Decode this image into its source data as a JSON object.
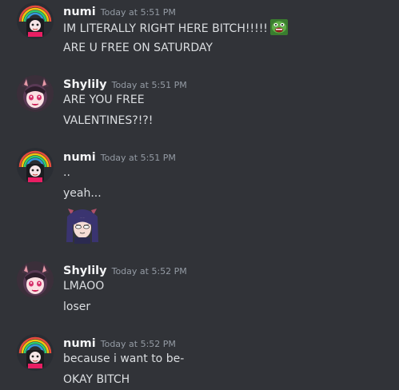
{
  "messages": [
    {
      "author": "numi",
      "timestamp": "Today at 5:51 PM",
      "lines": [
        "IM LITERALLY RIGHT HERE BITCH!!!!!",
        "ARE U FREE ON SATURDAY"
      ],
      "emote": "pepe-yelling-emote"
    },
    {
      "author": "Shylily",
      "timestamp": "Today at 5:51 PM",
      "lines": [
        "ARE YOU FREE",
        "VALENTINES?!?!"
      ]
    },
    {
      "author": "numi",
      "timestamp": "Today at 5:51 PM",
      "lines": [
        "..",
        "yeah..."
      ],
      "sticker": "anime-girl-sticker"
    },
    {
      "author": "Shylily",
      "timestamp": "Today at 5:52 PM",
      "lines": [
        "LMAOO",
        "loser"
      ]
    },
    {
      "author": "numi",
      "timestamp": "Today at 5:52 PM",
      "lines": [
        "because i want to be-",
        "OKAY BITCH"
      ]
    }
  ],
  "colors": {
    "background": "#313338",
    "username": "#f2f3f5",
    "timestamp": "#949ba4",
    "message_text": "#dbdee1"
  }
}
